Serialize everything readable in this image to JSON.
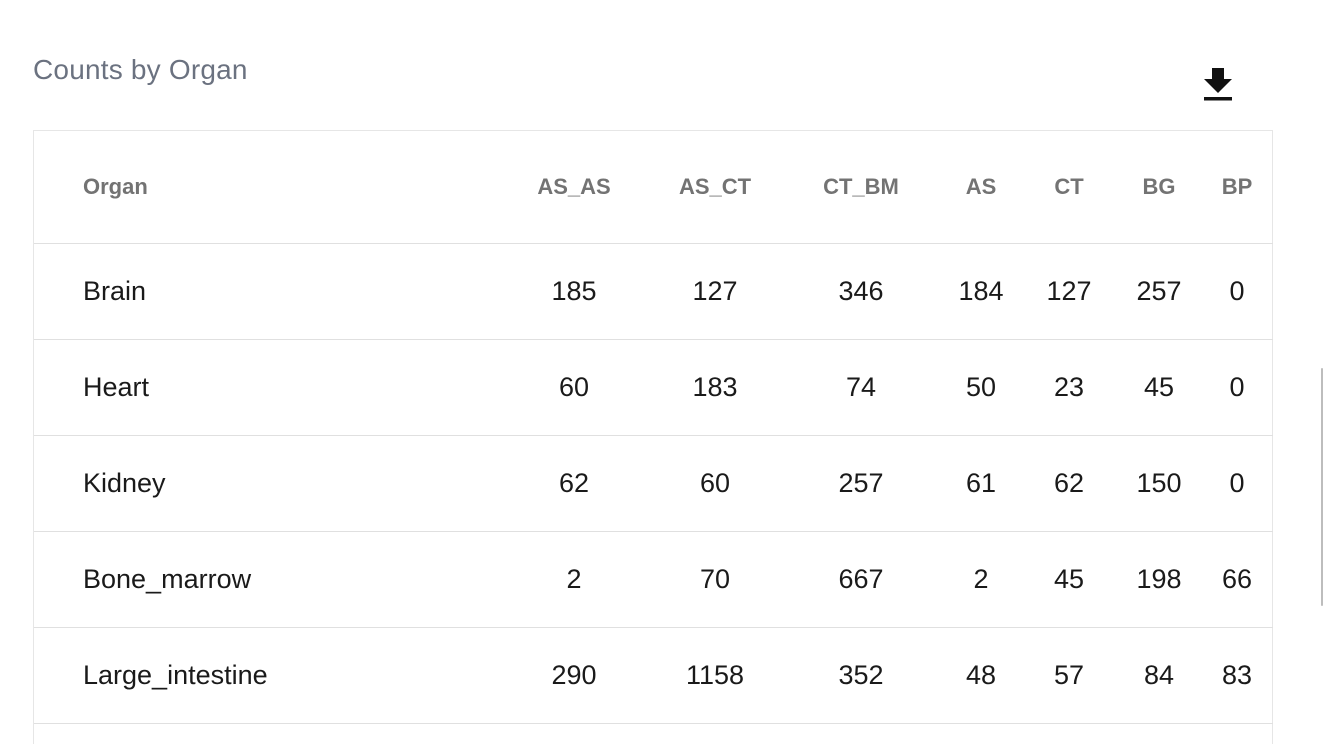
{
  "section": {
    "title": "Counts by Organ"
  },
  "toolbar": {
    "download_icon": "download-icon"
  },
  "table": {
    "columns": [
      "Organ",
      "AS_AS",
      "AS_CT",
      "CT_BM",
      "AS",
      "CT",
      "BG",
      "BP"
    ],
    "rows": [
      [
        "Brain",
        "185",
        "127",
        "346",
        "184",
        "127",
        "257",
        "0"
      ],
      [
        "Heart",
        "60",
        "183",
        "74",
        "50",
        "23",
        "45",
        "0"
      ],
      [
        "Kidney",
        "62",
        "60",
        "257",
        "61",
        "62",
        "150",
        "0"
      ],
      [
        "Bone_marrow",
        "2",
        "70",
        "667",
        "2",
        "45",
        "198",
        "66"
      ],
      [
        "Large_intestine",
        "290",
        "1158",
        "352",
        "48",
        "57",
        "84",
        "83"
      ]
    ]
  }
}
